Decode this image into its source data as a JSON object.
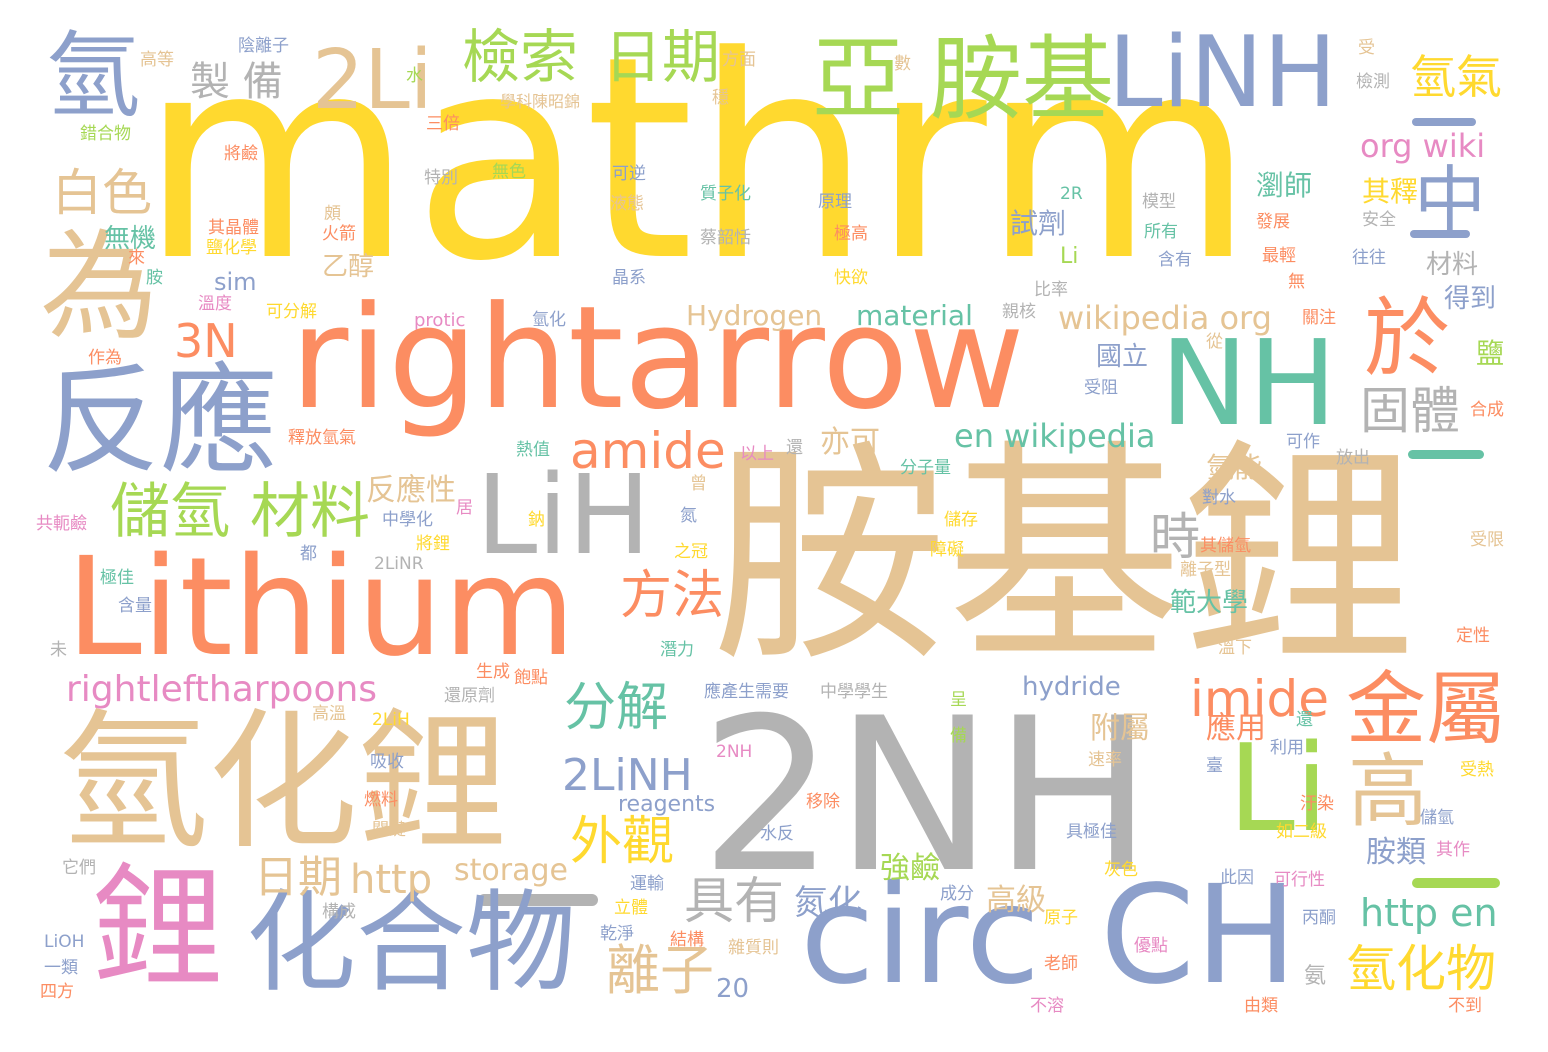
{
  "palette": {
    "yellow": "#FFD92F",
    "orange": "#FC8D62",
    "tan": "#E5C494",
    "blue": "#8DA0CB",
    "green": "#66C2A5",
    "pink": "#E78AC3",
    "lime": "#A6D854",
    "gray": "#B3B3B3"
  },
  "words": [
    {
      "text": "mathrm",
      "color": "yellow"
    },
    {
      "text": "胺基鋰",
      "color": "tan"
    },
    {
      "text": "2NH",
      "color": "gray"
    },
    {
      "text": "rightarrow",
      "color": "orange"
    },
    {
      "text": "Lithium",
      "color": "orange"
    },
    {
      "text": "氫化鋰",
      "color": "tan"
    },
    {
      "text": "反應",
      "color": "blue"
    },
    {
      "text": "化合物",
      "color": "blue"
    },
    {
      "text": "circ",
      "color": "blue"
    },
    {
      "text": "CH",
      "color": "blue"
    },
    {
      "text": "鋰",
      "color": "pink"
    },
    {
      "text": "LiH",
      "color": "gray"
    },
    {
      "text": "NH",
      "color": "green"
    },
    {
      "text": "LiNH",
      "color": "blue"
    },
    {
      "text": "胺基",
      "color": "lime"
    },
    {
      "text": "亞",
      "color": "lime"
    },
    {
      "text": "2Li",
      "color": "tan"
    },
    {
      "text": "為",
      "color": "tan"
    },
    {
      "text": "氫",
      "color": "blue"
    },
    {
      "text": "Li",
      "color": "lime"
    },
    {
      "text": "於",
      "color": "orange"
    },
    {
      "text": "中",
      "color": "blue"
    },
    {
      "text": "金屬",
      "color": "orange"
    },
    {
      "text": "高",
      "color": "tan"
    },
    {
      "text": "儲氫",
      "color": "lime"
    },
    {
      "text": "材料",
      "color": "lime"
    },
    {
      "text": "檢索",
      "color": "lime"
    },
    {
      "text": "日期",
      "color": "lime"
    },
    {
      "text": "amide",
      "color": "orange"
    },
    {
      "text": "imide",
      "color": "orange"
    },
    {
      "text": "3N",
      "color": "orange"
    },
    {
      "text": "白色",
      "color": "tan"
    },
    {
      "text": "固體",
      "color": "gray"
    },
    {
      "text": "方法",
      "color": "orange"
    },
    {
      "text": "分解",
      "color": "green"
    },
    {
      "text": "2LiNH",
      "color": "blue"
    },
    {
      "text": "外觀",
      "color": "yellow"
    },
    {
      "text": "具有",
      "color": "gray"
    },
    {
      "text": "離子",
      "color": "tan"
    },
    {
      "text": "氫化物",
      "color": "yellow"
    },
    {
      "text": "http en",
      "color": "green"
    },
    {
      "text": "rightleftharpoons",
      "color": "pink"
    },
    {
      "text": "氫氣",
      "color": "yellow"
    },
    {
      "text": "製 備",
      "color": "gray"
    },
    {
      "text": "日期",
      "color": "tan"
    },
    {
      "text": "http",
      "color": "tan"
    },
    {
      "text": "時",
      "color": "gray"
    },
    {
      "text": "en wikipedia",
      "color": "green"
    },
    {
      "text": "org wiki",
      "color": "pink"
    },
    {
      "text": "wikipedia org",
      "color": "tan"
    },
    {
      "text": "反應性",
      "color": "tan"
    },
    {
      "text": "亦可",
      "color": "tan"
    },
    {
      "text": "storage",
      "color": "tan"
    },
    {
      "text": "Hydrogen",
      "color": "tan"
    },
    {
      "text": "material",
      "color": "green"
    },
    {
      "text": "hydride",
      "color": "blue"
    },
    {
      "text": "reagents",
      "color": "blue"
    },
    {
      "text": "氮化",
      "color": "blue"
    },
    {
      "text": "高級",
      "color": "tan"
    },
    {
      "text": "強鹼",
      "color": "lime"
    },
    {
      "text": "胺類",
      "color": "blue"
    },
    {
      "text": "應用",
      "color": "orange"
    },
    {
      "text": "附屬",
      "color": "tan"
    },
    {
      "text": "國立",
      "color": "blue"
    },
    {
      "text": "試劑",
      "color": "blue"
    },
    {
      "text": "乙醇",
      "color": "tan"
    },
    {
      "text": "無機",
      "color": "green"
    },
    {
      "text": "瀏師",
      "color": "green"
    },
    {
      "text": "其釋",
      "color": "yellow"
    },
    {
      "text": "範大學",
      "color": "green"
    },
    {
      "text": "氫能",
      "color": "tan"
    },
    {
      "text": "得到",
      "color": "blue"
    },
    {
      "text": "材料",
      "color": "gray"
    },
    {
      "text": "sim",
      "color": "blue"
    },
    {
      "text": "20",
      "color": "blue"
    },
    {
      "text": "鹽",
      "color": "lime"
    },
    {
      "text": "學科陳昭錦",
      "color": "tan"
    },
    {
      "text": "陰離子",
      "color": "blue"
    },
    {
      "text": "高等",
      "color": "tan"
    },
    {
      "text": "方面",
      "color": "tan"
    },
    {
      "text": "數",
      "color": "tan"
    },
    {
      "text": "受",
      "color": "tan"
    },
    {
      "text": "檢測",
      "color": "gray"
    },
    {
      "text": "水",
      "color": "lime"
    },
    {
      "text": "三倍",
      "color": "orange"
    },
    {
      "text": "穩",
      "color": "tan"
    },
    {
      "text": "錯合物",
      "color": "lime"
    },
    {
      "text": "特別",
      "color": "gray"
    },
    {
      "text": "無色",
      "color": "lime"
    },
    {
      "text": "可逆",
      "color": "blue"
    },
    {
      "text": "質子化",
      "color": "green"
    },
    {
      "text": "原理",
      "color": "blue"
    },
    {
      "text": "2R",
      "color": "green"
    },
    {
      "text": "模型",
      "color": "gray"
    },
    {
      "text": "安全",
      "color": "gray"
    },
    {
      "text": "將鹼",
      "color": "orange"
    },
    {
      "text": "頗",
      "color": "tan"
    },
    {
      "text": "液態",
      "color": "tan"
    },
    {
      "text": "其晶體",
      "color": "orange"
    },
    {
      "text": "火箭",
      "color": "orange"
    },
    {
      "text": "蔡韶恬",
      "color": "gray"
    },
    {
      "text": "極高",
      "color": "orange"
    },
    {
      "text": "所有",
      "color": "green"
    },
    {
      "text": "發展",
      "color": "orange"
    },
    {
      "text": "鹽化學",
      "color": "yellow"
    },
    {
      "text": "來",
      "color": "orange"
    },
    {
      "text": "Li",
      "color": "lime"
    },
    {
      "text": "含有",
      "color": "blue"
    },
    {
      "text": "最輕",
      "color": "orange"
    },
    {
      "text": "往往",
      "color": "blue"
    },
    {
      "text": "胺",
      "color": "green"
    },
    {
      "text": "晶系",
      "color": "blue"
    },
    {
      "text": "快欲",
      "color": "yellow"
    },
    {
      "text": "無",
      "color": "orange"
    },
    {
      "text": "溫度",
      "color": "pink"
    },
    {
      "text": "可分解",
      "color": "yellow"
    },
    {
      "text": "比率",
      "color": "gray"
    },
    {
      "text": "親核",
      "color": "gray"
    },
    {
      "text": "protic",
      "color": "pink"
    },
    {
      "text": "氫化",
      "color": "blue"
    },
    {
      "text": "關注",
      "color": "orange"
    },
    {
      "text": "作為",
      "color": "orange"
    },
    {
      "text": "從",
      "color": "tan"
    },
    {
      "text": "受阻",
      "color": "blue"
    },
    {
      "text": "合成",
      "color": "orange"
    },
    {
      "text": "釋放氫氣",
      "color": "orange"
    },
    {
      "text": "熱值",
      "color": "green"
    },
    {
      "text": "以上",
      "color": "pink"
    },
    {
      "text": "還",
      "color": "gray"
    },
    {
      "text": "分子量",
      "color": "green"
    },
    {
      "text": "可作",
      "color": "blue"
    },
    {
      "text": "放出",
      "color": "gray"
    },
    {
      "text": "曾",
      "color": "tan"
    },
    {
      "text": "共軛鹼",
      "color": "pink"
    },
    {
      "text": "中學化",
      "color": "blue"
    },
    {
      "text": "居",
      "color": "pink"
    },
    {
      "text": "鈉",
      "color": "yellow"
    },
    {
      "text": "氮",
      "color": "blue"
    },
    {
      "text": "儲存",
      "color": "yellow"
    },
    {
      "text": "對水",
      "color": "blue"
    },
    {
      "text": "受限",
      "color": "tan"
    },
    {
      "text": "極佳",
      "color": "green"
    },
    {
      "text": "都",
      "color": "blue"
    },
    {
      "text": "2LiNR",
      "color": "gray"
    },
    {
      "text": "將鋰",
      "color": "yellow"
    },
    {
      "text": "之冠",
      "color": "yellow"
    },
    {
      "text": "障礙",
      "color": "yellow"
    },
    {
      "text": "其儲氫",
      "color": "orange"
    },
    {
      "text": "離子型",
      "color": "tan"
    },
    {
      "text": "含量",
      "color": "blue"
    },
    {
      "text": "未",
      "color": "gray"
    },
    {
      "text": "潛力",
      "color": "green"
    },
    {
      "text": "溫下",
      "color": "tan"
    },
    {
      "text": "定性",
      "color": "orange"
    },
    {
      "text": "生成",
      "color": "orange"
    },
    {
      "text": "飽點",
      "color": "orange"
    },
    {
      "text": "還原劑",
      "color": "gray"
    },
    {
      "text": "應產生需要",
      "color": "blue"
    },
    {
      "text": "中學學生",
      "color": "gray"
    },
    {
      "text": "呈",
      "color": "lime"
    },
    {
      "text": "高溫",
      "color": "tan"
    },
    {
      "text": "2LiH",
      "color": "yellow"
    },
    {
      "text": "備",
      "color": "lime"
    },
    {
      "text": "還",
      "color": "green"
    },
    {
      "text": "利用",
      "color": "blue"
    },
    {
      "text": "吸收",
      "color": "blue"
    },
    {
      "text": "2NH",
      "color": "pink"
    },
    {
      "text": "速率",
      "color": "tan"
    },
    {
      "text": "臺",
      "color": "blue"
    },
    {
      "text": "受熱",
      "color": "yellow"
    },
    {
      "text": "燃料",
      "color": "orange"
    },
    {
      "text": "移除",
      "color": "orange"
    },
    {
      "text": "汙染",
      "color": "orange"
    },
    {
      "text": "儲氫",
      "color": "blue"
    },
    {
      "text": "關鍵",
      "color": "tan"
    },
    {
      "text": "水反",
      "color": "blue"
    },
    {
      "text": "具極佳",
      "color": "blue"
    },
    {
      "text": "如二級",
      "color": "yellow"
    },
    {
      "text": "其作",
      "color": "pink"
    },
    {
      "text": "它們",
      "color": "gray"
    },
    {
      "text": "灰色",
      "color": "yellow"
    },
    {
      "text": "運輸",
      "color": "blue"
    },
    {
      "text": "此因",
      "color": "blue"
    },
    {
      "text": "可行性",
      "color": "pink"
    },
    {
      "text": "構成",
      "color": "gray"
    },
    {
      "text": "立體",
      "color": "yellow"
    },
    {
      "text": "成分",
      "color": "blue"
    },
    {
      "text": "原子",
      "color": "yellow"
    },
    {
      "text": "丙酮",
      "color": "blue"
    },
    {
      "text": "LiOH",
      "color": "blue"
    },
    {
      "text": "乾淨",
      "color": "blue"
    },
    {
      "text": "結構",
      "color": "orange"
    },
    {
      "text": "雜質則",
      "color": "tan"
    },
    {
      "text": "優點",
      "color": "pink"
    },
    {
      "text": "一類",
      "color": "blue"
    },
    {
      "text": "老師",
      "color": "orange"
    },
    {
      "text": "氨",
      "color": "gray"
    },
    {
      "text": "四方",
      "color": "orange"
    },
    {
      "text": "不溶",
      "color": "pink"
    },
    {
      "text": "由類",
      "color": "orange"
    },
    {
      "text": "不到",
      "color": "orange"
    }
  ]
}
